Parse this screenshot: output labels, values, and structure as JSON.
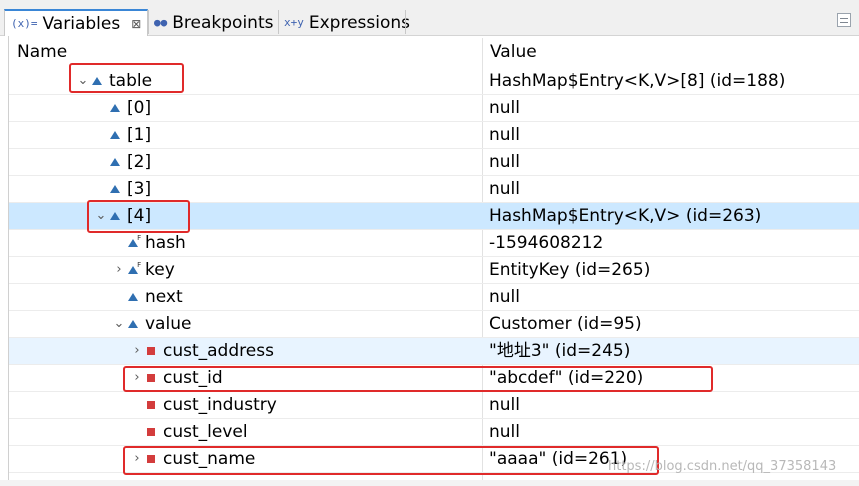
{
  "tabs": [
    {
      "label": "Variables",
      "icon": "(x)=",
      "active": true
    },
    {
      "label": "Breakpoints",
      "icon": "●●",
      "active": false
    },
    {
      "label": "Expressions",
      "icon": "x+y",
      "active": false
    }
  ],
  "tab_close_glyph": "⊠",
  "columns": {
    "name": "Name",
    "value": "Value"
  },
  "rows": [
    {
      "name": "table",
      "value": "HashMap$Entry<K,V>[8]  (id=188)",
      "expander": "⌄",
      "icon": "field-triangle-icon"
    },
    {
      "name": "[0]",
      "value": "null",
      "expander": "",
      "icon": "field-triangle-icon"
    },
    {
      "name": "[1]",
      "value": "null",
      "expander": "",
      "icon": "field-triangle-icon"
    },
    {
      "name": "[2]",
      "value": "null",
      "expander": "",
      "icon": "field-triangle-icon"
    },
    {
      "name": "[3]",
      "value": "null",
      "expander": "",
      "icon": "field-triangle-icon"
    },
    {
      "name": "[4]",
      "value": "HashMap$Entry<K,V>  (id=263)",
      "expander": "⌄",
      "icon": "field-triangle-icon"
    },
    {
      "name": "hash",
      "value": "-1594608212",
      "expander": "",
      "icon": "final-field-icon"
    },
    {
      "name": "key",
      "value": "EntityKey  (id=265)",
      "expander": "›",
      "icon": "final-field-icon"
    },
    {
      "name": "next",
      "value": "null",
      "expander": "",
      "icon": "field-triangle-icon"
    },
    {
      "name": "value",
      "value": "Customer  (id=95)",
      "expander": "⌄",
      "icon": "field-triangle-icon"
    },
    {
      "name": "cust_address",
      "value": "\"地址3\" (id=245)",
      "expander": "›",
      "icon": "private-field-icon"
    },
    {
      "name": "cust_id",
      "value": "\"abcdef\" (id=220)",
      "expander": "›",
      "icon": "private-field-icon"
    },
    {
      "name": "cust_industry",
      "value": "null",
      "expander": "",
      "icon": "private-field-icon"
    },
    {
      "name": "cust_level",
      "value": "null",
      "expander": "",
      "icon": "private-field-icon"
    },
    {
      "name": "cust_name",
      "value": "\"aaaa\" (id=261)",
      "expander": "›",
      "icon": "private-field-icon"
    }
  ],
  "watermark": "https://blog.csdn.net/qq_37358143",
  "colors": {
    "selection": "#cce8ff",
    "highlight_box": "#e02a2a",
    "field_icon": "#2f6fb1",
    "private_icon": "#d33c3c"
  }
}
